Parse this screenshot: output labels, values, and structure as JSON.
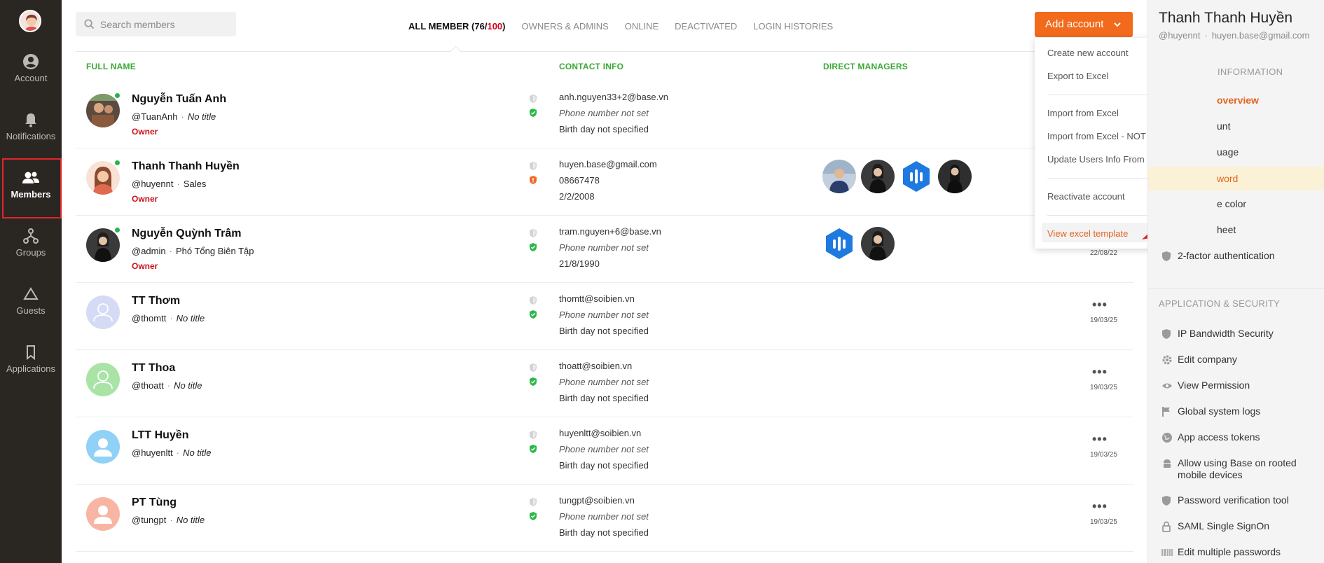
{
  "nav": {
    "items": [
      {
        "label": "Account",
        "icon": "account-circle-icon"
      },
      {
        "label": "Notifications",
        "icon": "bell-icon"
      },
      {
        "label": "Members",
        "icon": "members-icon"
      },
      {
        "label": "Groups",
        "icon": "groups-icon"
      },
      {
        "label": "Guests",
        "icon": "triangle-icon"
      },
      {
        "label": "Applications",
        "icon": "bookmark-icon"
      }
    ],
    "active": "Members"
  },
  "search": {
    "placeholder": "Search members"
  },
  "tabs": {
    "all_prefix": "ALL MEMBER (",
    "all_count": "76",
    "all_slash": "/",
    "all_max": "100",
    "all_suffix": ")",
    "owners": "OWNERS & ADMINS",
    "online": "ONLINE",
    "deactivated": "DEACTIVATED",
    "login": "LOGIN HISTORIES"
  },
  "columns": {
    "full_name": "FULL NAME",
    "contact": "CONTACT INFO",
    "managers": "DIRECT MANAGERS"
  },
  "add_account": {
    "label": "Add account",
    "chevron": "chevron-down-icon"
  },
  "dropdown": {
    "create": "Create new account",
    "export": "Export to Excel",
    "import": "Import from Excel",
    "import_no_email": "Import from Excel - NOT sending emails",
    "update": "Update Users Info From Excel",
    "reactivate": "Reactivate account",
    "view_template": "View excel template"
  },
  "members": [
    {
      "name": "Nguyễn Tuấn Anh",
      "handle": "@TuanAnh",
      "title": "No title",
      "title_missing": true,
      "role": "Owner",
      "online": true,
      "email": "anh.nguyen33+2@base.vn",
      "phone": "Phone number not set",
      "phone_missing": true,
      "birthday": "Birth day not specified",
      "birthday_missing": false,
      "shield2": "green",
      "date": ""
    },
    {
      "name": "Thanh Thanh Huyền",
      "handle": "@huyennt",
      "title": "Sales",
      "title_missing": false,
      "role": "Owner",
      "online": true,
      "email": "huyen.base@gmail.com",
      "phone": "08667478",
      "phone_missing": false,
      "birthday": "2/2/2008",
      "birthday_missing": false,
      "shield2": "orange",
      "date": ""
    },
    {
      "name": "Nguyễn Quỳnh Trâm",
      "handle": "@admin",
      "title": "Phó Tổng Biên Tập",
      "title_missing": false,
      "role": "Owner",
      "online": true,
      "email": "tram.nguyen+6@base.vn",
      "phone": "Phone number not set",
      "phone_missing": true,
      "birthday": "21/8/1990",
      "birthday_missing": false,
      "shield2": "green",
      "date": "22/08/22"
    },
    {
      "name": "TT Thơm",
      "handle": "@thomtt",
      "title": "No title",
      "title_missing": true,
      "role": "",
      "online": false,
      "email": "thomtt@soibien.vn",
      "phone": "Phone number not set",
      "phone_missing": true,
      "birthday": "Birth day not specified",
      "birthday_missing": false,
      "shield2": "green",
      "date": "19/03/25"
    },
    {
      "name": "TT Thoa",
      "handle": "@thoatt",
      "title": "No title",
      "title_missing": true,
      "role": "",
      "online": false,
      "email": "thoatt@soibien.vn",
      "phone": "Phone number not set",
      "phone_missing": true,
      "birthday": "Birth day not specified",
      "birthday_missing": false,
      "shield2": "green",
      "date": "19/03/25"
    },
    {
      "name": "LTT Huyền",
      "handle": "@huyenltt",
      "title": "No title",
      "title_missing": true,
      "role": "",
      "online": false,
      "email": "huyenltt@soibien.vn",
      "phone": "Phone number not set",
      "phone_missing": true,
      "birthday": "Birth day not specified",
      "birthday_missing": false,
      "shield2": "green",
      "date": "19/03/25"
    },
    {
      "name": "PT Tùng",
      "handle": "@tungpt",
      "title": "No title",
      "title_missing": true,
      "role": "",
      "online": false,
      "email": "tungpt@soibien.vn",
      "phone": "Phone number not set",
      "phone_missing": true,
      "birthday": "Birth day not specified",
      "birthday_missing": false,
      "shield2": "green",
      "date": "19/03/25"
    }
  ],
  "more_label": "•••",
  "colors": {
    "accent": "#f26a1b",
    "green": "#3aa935",
    "owner_red": "#c9131b",
    "nav_bg": "#2a2622"
  },
  "right_panel": {
    "name": "Thanh Thanh Huyền",
    "handle": "@huyennt",
    "dot": "·",
    "email": "huyen.base@gmail.com",
    "section_info": "INFORMATION",
    "info_items": [
      {
        "label": "overview",
        "icon": "info-icon"
      },
      {
        "label": "unt",
        "icon": "account-icon"
      },
      {
        "label": "uage",
        "icon": "language-icon"
      },
      {
        "label": "word",
        "icon": "key-icon"
      },
      {
        "label": "e color",
        "icon": "palette-icon"
      },
      {
        "label": "heet",
        "icon": "sheet-icon"
      },
      {
        "label": "2-factor authentication",
        "icon": "shield-icon"
      }
    ],
    "section_app": "APPLICATION & SECURITY",
    "app_items": [
      {
        "label": "IP Bandwidth Security",
        "icon": "shield-icon"
      },
      {
        "label": "Edit company",
        "icon": "gear-icon"
      },
      {
        "label": "View Permission",
        "icon": "eye-icon"
      },
      {
        "label": "Global system logs",
        "icon": "flag-icon"
      },
      {
        "label": "App access tokens",
        "icon": "globe-icon"
      },
      {
        "label": "Allow using Base on rooted",
        "label2": "mobile devices",
        "icon": "android-icon"
      },
      {
        "label": "Password verification tool",
        "icon": "shield-icon"
      },
      {
        "label": "SAML Single SignOn",
        "icon": "lock-icon"
      },
      {
        "label": "Edit multiple passwords",
        "icon": "barcode-icon"
      }
    ]
  }
}
